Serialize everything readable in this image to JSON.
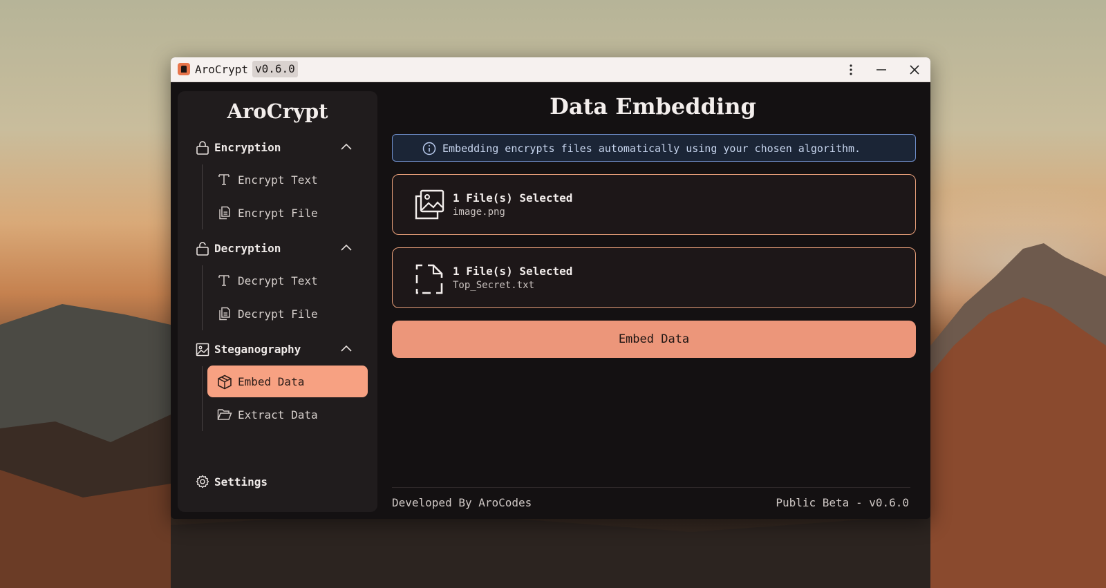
{
  "window": {
    "title": "AroCrypt",
    "version_chip": "v0.6.0"
  },
  "sidebar": {
    "brand": "AroCrypt",
    "sections": [
      {
        "label": "Encryption",
        "icon": "lock-icon",
        "expanded": true,
        "items": [
          {
            "label": "Encrypt Text",
            "icon": "text-icon"
          },
          {
            "label": "Encrypt File",
            "icon": "file-copy-icon"
          }
        ]
      },
      {
        "label": "Decryption",
        "icon": "unlock-icon",
        "expanded": true,
        "items": [
          {
            "label": "Decrypt Text",
            "icon": "text-icon"
          },
          {
            "label": "Decrypt File",
            "icon": "file-copy-icon"
          }
        ]
      },
      {
        "label": "Steganography",
        "icon": "image-icon",
        "expanded": true,
        "items": [
          {
            "label": "Embed Data",
            "icon": "package-icon",
            "active": true
          },
          {
            "label": "Extract Data",
            "icon": "folder-open-icon"
          }
        ]
      }
    ],
    "settings_label": "Settings"
  },
  "main": {
    "title": "Data Embedding",
    "info": "Embedding encrypts files automatically using your chosen algorithm.",
    "cards": [
      {
        "count": "1 File(s) Selected",
        "filename": "image.png",
        "icon": "images-icon"
      },
      {
        "count": "1 File(s) Selected",
        "filename": "Top_Secret.txt",
        "icon": "file-dashed-icon"
      }
    ],
    "embed_button": "Embed Data"
  },
  "footer": {
    "left": "Developed By AroCodes",
    "right": "Public Beta - v0.6.0"
  },
  "colors": {
    "accent": "#ec967a",
    "active_nav": "#f7a182",
    "info_border": "#6f8fcb",
    "card_border": "#e9a07a",
    "window_bg": "#141112",
    "sidebar_bg": "#201c1d"
  }
}
